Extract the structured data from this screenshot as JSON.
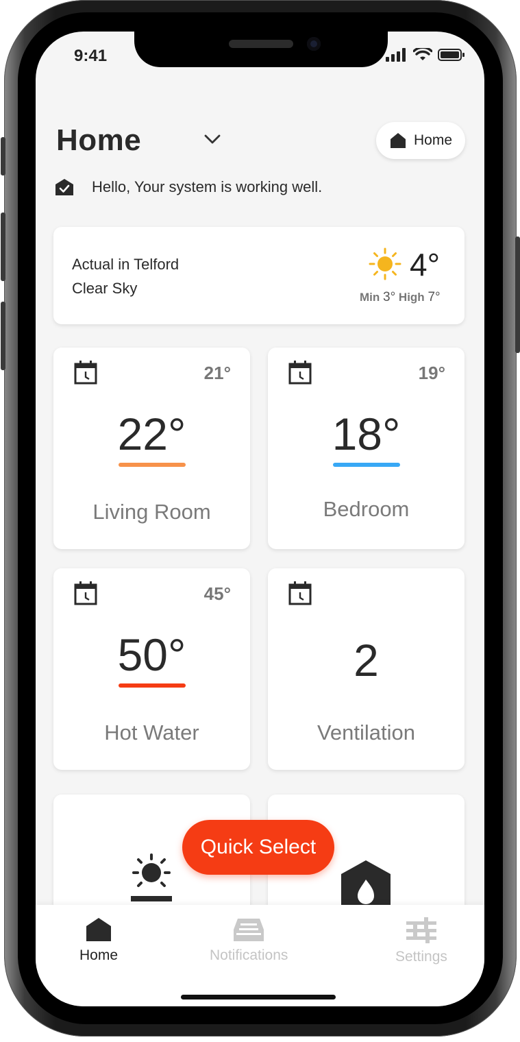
{
  "status_bar": {
    "time": "9:41"
  },
  "header": {
    "title": "Home",
    "home_button_label": "Home",
    "status_message": "Hello, Your system is working well."
  },
  "weather": {
    "location": "Actual in Telford",
    "condition": "Clear Sky",
    "current_temp": "4°",
    "min_label": "Min",
    "min_value": "3°",
    "high_label": "High",
    "high_value": "7°",
    "icon": "sun-icon",
    "sun_color": "#f5b51e"
  },
  "zones": [
    {
      "name": "Living Room",
      "current": "22°",
      "setpoint": "21°",
      "accent": "#f7924a"
    },
    {
      "name": "Bedroom",
      "current": "18°",
      "setpoint": "19°",
      "accent": "#38a8f5"
    },
    {
      "name": "Hot Water",
      "current": "50°",
      "setpoint": "45°",
      "accent": "#f53c14"
    },
    {
      "name": "Ventilation",
      "current": "2",
      "setpoint": ""
    }
  ],
  "partial_tiles": [
    {
      "icon": "solar-panel-icon"
    },
    {
      "icon": "flame-house-icon"
    }
  ],
  "quick_select": {
    "label": "Quick Select",
    "color": "#f53c14"
  },
  "tab_bar": {
    "home_label": "Home",
    "notifications_label": "Notifications",
    "settings_label": "Settings"
  }
}
